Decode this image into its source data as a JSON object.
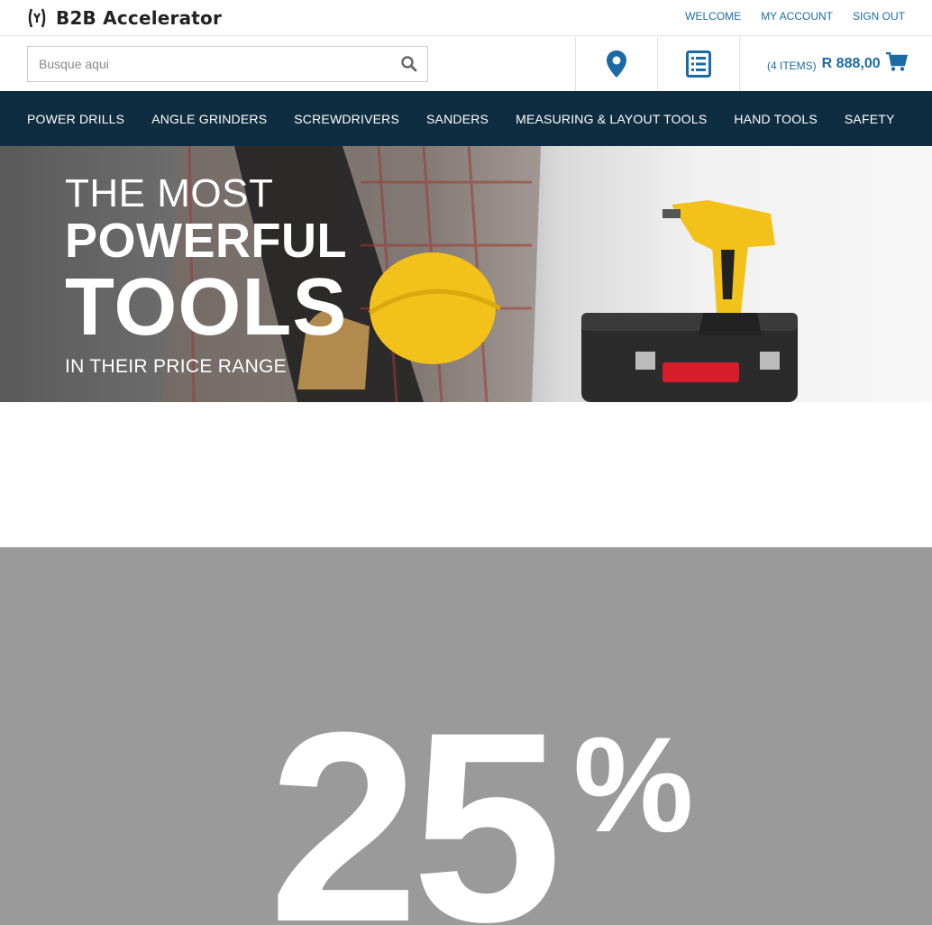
{
  "brand": {
    "name": "B2B Accelerator"
  },
  "top_links": [
    "WELCOME",
    "MY ACCOUNT",
    "SIGN OUT"
  ],
  "search": {
    "placeholder": "Busque aqui",
    "value": ""
  },
  "cart": {
    "count_label": "(4 ITEMS)",
    "total": "R 888,00"
  },
  "icons": {
    "search": "search-icon",
    "location": "map-marker-icon",
    "list": "list-icon",
    "cart": "shopping-cart-icon"
  },
  "nav": [
    "POWER DRILLS",
    "ANGLE GRINDERS",
    "SCREWDRIVERS",
    "SANDERS",
    "MEASURING & LAYOUT TOOLS",
    "HAND TOOLS",
    "SAFETY"
  ],
  "hero": {
    "line1": "THE MOST",
    "line2": "POWERFUL",
    "line3": "TOOLS",
    "line4": "IN THEIR PRICE RANGE"
  },
  "promo": {
    "number": "25",
    "symbol": "%"
  },
  "colors": {
    "accent": "#1a6aa6",
    "nav_bg": "#0f2d40",
    "promo_bg": "#9a9a9a",
    "drill_yellow": "#f2c21a"
  }
}
